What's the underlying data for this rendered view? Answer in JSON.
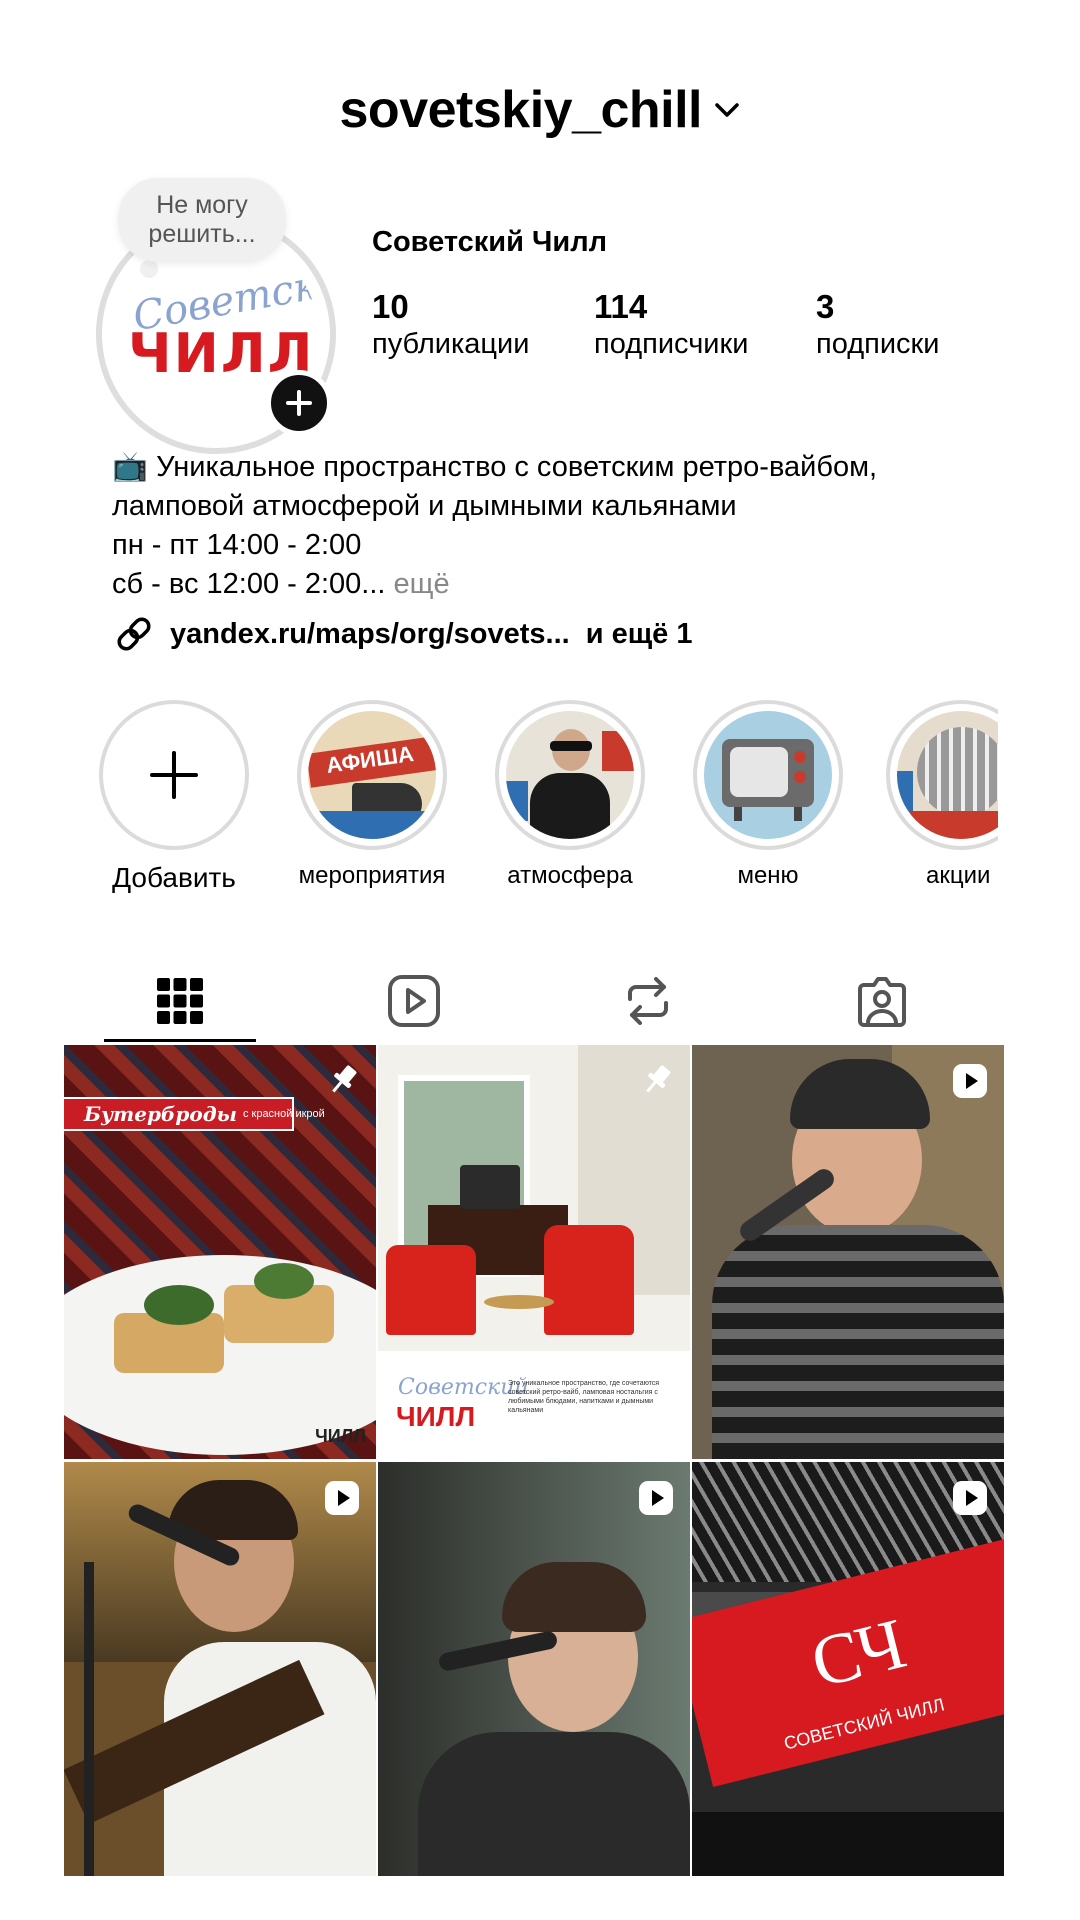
{
  "header": {
    "username": "sovetskiy_chill"
  },
  "note": {
    "text_line1": "Не могу",
    "text_line2": "решить..."
  },
  "avatar": {
    "script_text": "Советский",
    "logo_text": "ЧИЛЛ"
  },
  "profile": {
    "display_name": "Советский Чилл",
    "stats": [
      {
        "value": "10",
        "label": "публикации"
      },
      {
        "value": "114",
        "label": "подписчики"
      },
      {
        "value": "3",
        "label": "подписки"
      }
    ],
    "bio_line1": "📺 Уникальное пространство с советским ретро-вайбом,",
    "bio_line2": "ламповой атмосферой и дымными кальянами",
    "bio_line3": "пн - пт 14:00 - 2:00",
    "bio_line4": "сб - вс 12:00 - 2:00...",
    "bio_more": "ещё",
    "link_text": "yandex.ru/maps/org/sovets...",
    "link_more": "и ещё 1"
  },
  "highlights": [
    {
      "label": "Добавить"
    },
    {
      "label": "мероприятия",
      "cover_text": "АФИША"
    },
    {
      "label": "атмосфера"
    },
    {
      "label": "меню"
    },
    {
      "label": "акции"
    }
  ],
  "grid": {
    "post1_banner": "Бутерброды",
    "post1_banner_small": "с красной икрой",
    "post1_logo": "ЧИЛЛ",
    "post2_logo_script": "Советский",
    "post2_logo": "ЧИЛЛ",
    "post2_caption": "Это уникальное пространство, где сочетаются советский ретро-вайб, ламповая ностальгия с любимыми блюдами, напитками и дымными кальянами",
    "post6_sign": "СЧ",
    "post6_sign_small": "СОВЕТСКИЙ ЧИЛЛ"
  },
  "colors": {
    "brand_red": "#d71920",
    "muted_text": "#888888",
    "border_gray": "#dbdbdb"
  }
}
